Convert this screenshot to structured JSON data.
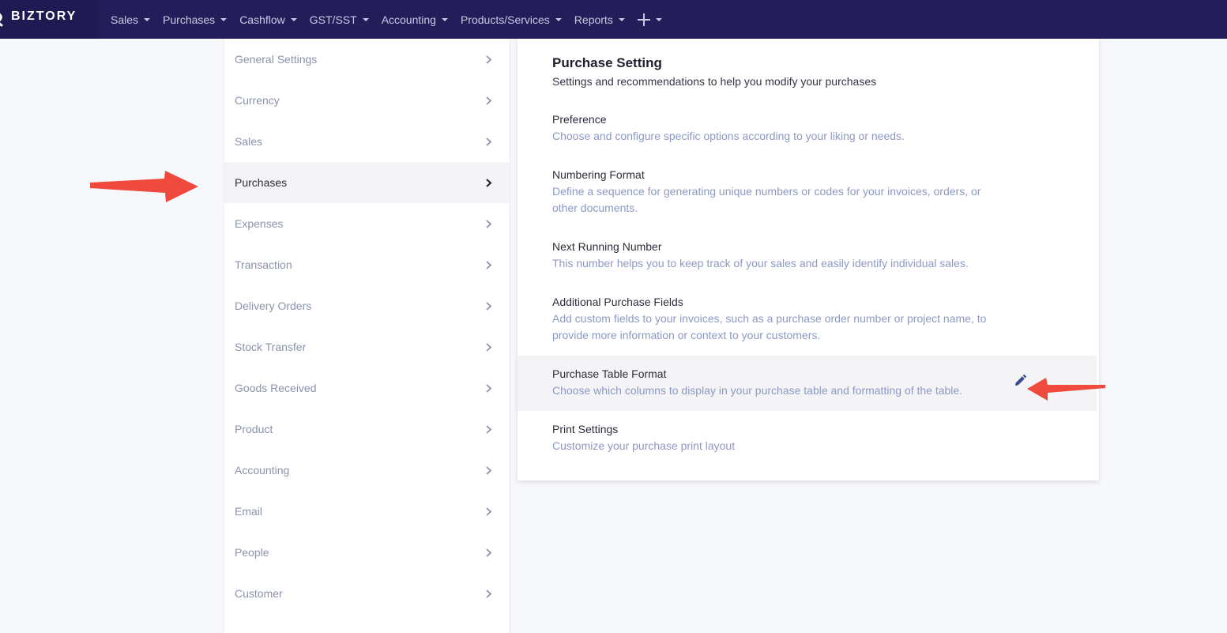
{
  "navbar": {
    "brand": "BIZTORY",
    "items": [
      {
        "label": "Sales",
        "icon": "chevron-down-icon"
      },
      {
        "label": "Purchases",
        "icon": "chevron-down-icon"
      },
      {
        "label": "Cashflow",
        "icon": "chevron-down-icon"
      },
      {
        "label": "GST/SST",
        "icon": "chevron-down-icon"
      },
      {
        "label": "Accounting",
        "icon": "chevron-down-icon"
      },
      {
        "label": "Products/Services",
        "icon": "chevron-down-icon"
      },
      {
        "label": "Reports",
        "icon": "chevron-down-icon"
      }
    ],
    "add_icon": "plus-icon"
  },
  "side_menu": {
    "items": [
      {
        "label": "General Settings"
      },
      {
        "label": "Currency"
      },
      {
        "label": "Sales"
      },
      {
        "label": "Purchases",
        "active": true
      },
      {
        "label": "Expenses"
      },
      {
        "label": "Transaction"
      },
      {
        "label": "Delivery Orders"
      },
      {
        "label": "Stock Transfer"
      },
      {
        "label": "Goods Received"
      },
      {
        "label": "Product"
      },
      {
        "label": "Accounting"
      },
      {
        "label": "Email"
      },
      {
        "label": "People"
      },
      {
        "label": "Customer"
      }
    ]
  },
  "main": {
    "title": "Purchase Setting",
    "subtitle": "Settings and recommendations to help you modify your purchases",
    "settings": [
      {
        "title": "Preference",
        "description": "Choose and configure specific options according to your liking or needs."
      },
      {
        "title": "Numbering Format",
        "description": "Define a sequence for generating unique numbers or codes for your invoices, orders, or other documents."
      },
      {
        "title": "Next Running Number",
        "description": "This number helps you to keep track of your sales and easily identify individual sales."
      },
      {
        "title": "Additional Purchase Fields",
        "description": "Add custom fields to your invoices, such as a purchase order number or project name, to provide more information or context to your customers."
      },
      {
        "title": "Purchase Table Format",
        "description": "Choose which columns to display in your purchase table and formatting of the table.",
        "highlighted": true,
        "icon": "pencil-icon"
      },
      {
        "title": "Print Settings",
        "description": "Customize your purchase print layout"
      }
    ]
  },
  "colors": {
    "navbar_bg": "#231e5a",
    "annotation_arrow": "#f04a3e",
    "muted_text": "#8a93ab",
    "description_text": "#8d99c3",
    "pencil": "#3b4a8c"
  }
}
